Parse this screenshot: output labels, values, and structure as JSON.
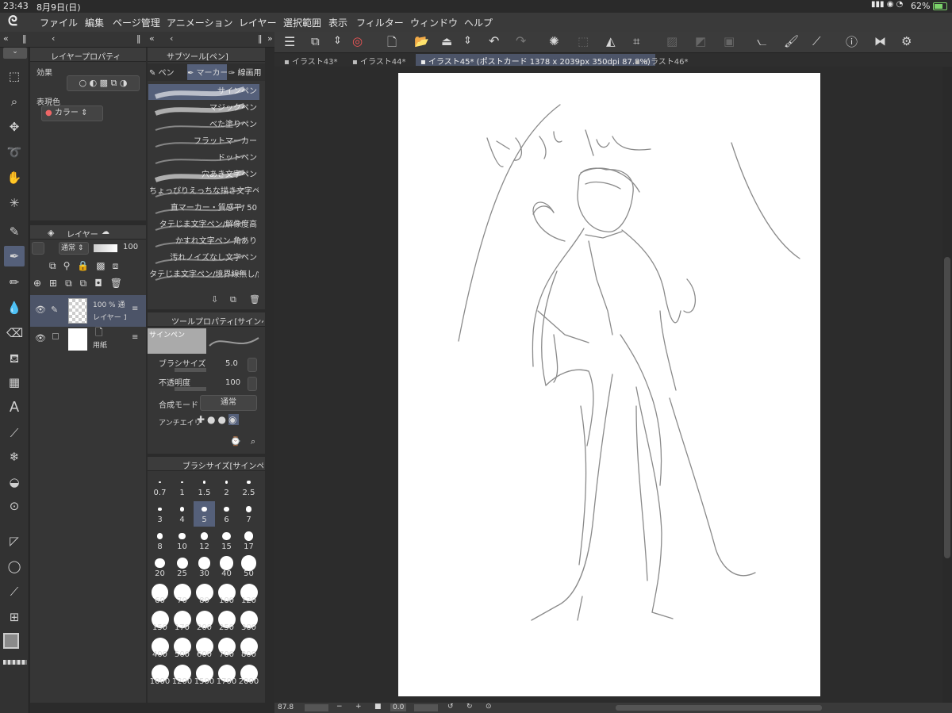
{
  "status": {
    "time": "23:43",
    "date": "8月9日(日)",
    "battery": "62%"
  },
  "menu": [
    "ファイル",
    "編集",
    "ページ管理",
    "アニメーション",
    "レイヤー",
    "選択範囲",
    "表示",
    "フィルター",
    "ウィンドウ",
    "ヘルプ"
  ],
  "tabs": [
    "イラスト43*",
    "イラスト44*",
    "イラスト45* (ポストカード 1378 x 2039px 350dpi 87.8%)",
    "イラスト46*"
  ],
  "layer_property": {
    "title": "レイヤープロパティ",
    "effect_label": "効果",
    "color_label": "表現色",
    "color_value": "カラー"
  },
  "layer_panel": {
    "tab": "レイヤー",
    "blend": "通常",
    "opacity": "100",
    "layers": [
      {
        "line1": "100 % 通",
        "line2": "レイヤー 1"
      },
      {
        "line1": "",
        "line2": "用紙"
      }
    ]
  },
  "subtool": {
    "title": "サブツール[ペン]",
    "tabs": [
      "ペン",
      "マーカー",
      "線画用"
    ],
    "items": [
      "サインペン",
      "マジックペン",
      "べた塗りペン",
      "フラットマーカー",
      "ドットペン",
      "穴あき文字ペン",
      "ちょっぴりえっちな描き文字ペン",
      "直マーカー・質感平/ 50",
      "タテじま文字ペン/解像度高",
      "かすれ文字ペン 角あり",
      "汚れノイズなし文字ペン",
      "タテじま文字ペン/境界線無し/解"
    ]
  },
  "tool_property": {
    "title": "ツールプロパティ[サインペン]",
    "preview_label": "サインペン",
    "brush_size_label": "ブラシサイズ",
    "brush_size": "5.0",
    "opacity_label": "不透明度",
    "opacity": "100",
    "blend_label": "合成モード",
    "blend": "通常",
    "aa_label": "アンチエイリ"
  },
  "brush_size_panel": {
    "title": "ブラシサイズ[サインペン]",
    "sizes": [
      "0.7",
      "1",
      "1.5",
      "2",
      "2.5",
      "3",
      "4",
      "5",
      "6",
      "7",
      "8",
      "10",
      "12",
      "15",
      "17",
      "20",
      "25",
      "30",
      "40",
      "50",
      "60",
      "70",
      "80",
      "100",
      "120",
      "150",
      "170",
      "200",
      "250",
      "300",
      "400",
      "500",
      "600",
      "700",
      "800",
      "1000",
      "1200",
      "1500",
      "1700",
      "2000"
    ],
    "selected": "5"
  },
  "bottom": {
    "zoom": "87.8",
    "angle": "0.0"
  },
  "colors": {
    "accent": "#55607a",
    "panel": "#363636",
    "canvas_bg": "#2c2c2c",
    "stroke": "#8a8a8a"
  }
}
